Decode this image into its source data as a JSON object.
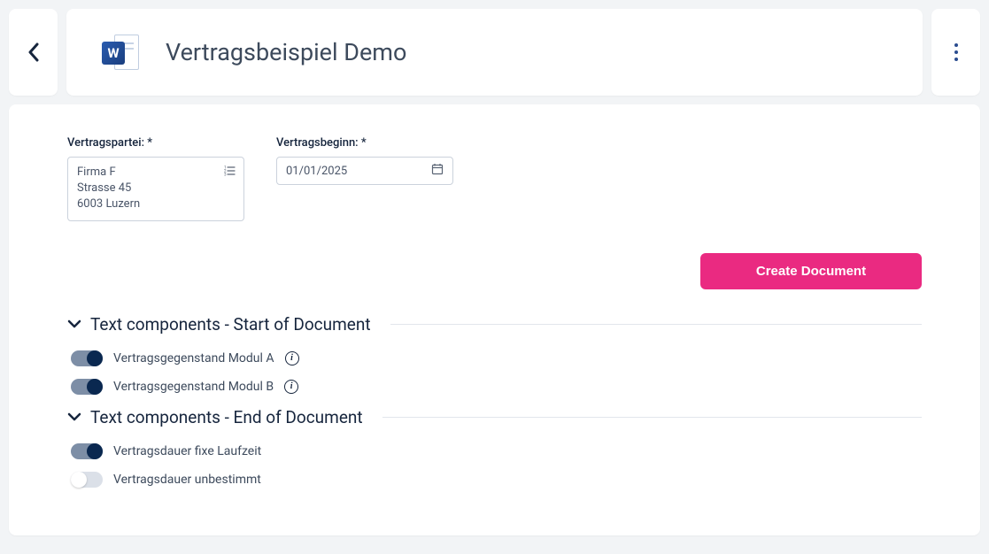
{
  "header": {
    "title": "Vertragsbeispiel Demo"
  },
  "form": {
    "party": {
      "label": "Vertragspartei: *",
      "line1": "Firma F",
      "line2": "Strasse 45",
      "line3": "6003 Luzern"
    },
    "start": {
      "label": "Vertragsbeginn: *",
      "value": "01/01/2025"
    }
  },
  "actions": {
    "create": "Create Document"
  },
  "sections": {
    "start": {
      "title": "Text components - Start of Document",
      "items": [
        {
          "label": "Vertragsgegenstand Modul A",
          "on": true,
          "info": true
        },
        {
          "label": "Vertragsgegenstand Modul B",
          "on": true,
          "info": true
        }
      ]
    },
    "end": {
      "title": "Text components - End of Document",
      "items": [
        {
          "label": "Vertragsdauer fixe Laufzeit",
          "on": true,
          "info": false
        },
        {
          "label": "Vertragsdauer unbestimmt",
          "on": false,
          "info": false
        }
      ]
    }
  }
}
